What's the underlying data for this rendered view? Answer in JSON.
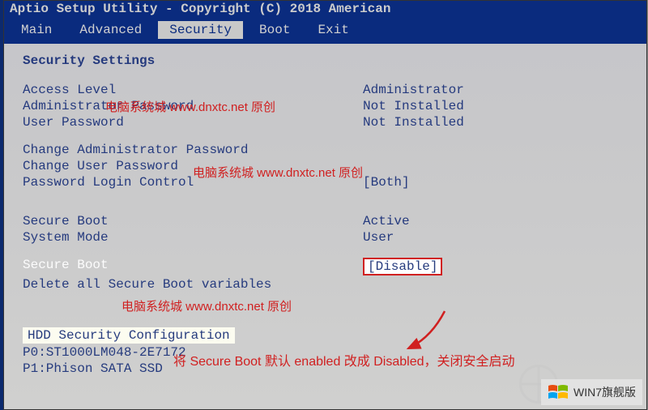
{
  "title_bar": "Aptio Setup Utility - Copyright (C) 2018 American",
  "nav": {
    "items": [
      "Main",
      "Advanced",
      "Security",
      "Boot",
      "Exit"
    ],
    "active_index": 2
  },
  "section_header": "Security Settings",
  "fields": {
    "access_level": {
      "label": "Access Level",
      "value": "Administrator"
    },
    "admin_pw": {
      "label": "Administrator Password",
      "value": "Not Installed"
    },
    "user_pw": {
      "label": "User Password",
      "value": "Not Installed"
    },
    "change_admin": {
      "label": "Change Administrator Password"
    },
    "change_user": {
      "label": "Change User Password"
    },
    "login_ctrl": {
      "label": "Password Login Control",
      "value": "[Both]"
    },
    "secure_boot_status": {
      "label": "Secure Boot",
      "value": "Active"
    },
    "system_mode": {
      "label": "System Mode",
      "value": "User"
    },
    "secure_boot_toggle": {
      "label": "Secure Boot",
      "value": "[Disable]"
    },
    "delete_vars": {
      "label": "Delete all Secure Boot variables"
    }
  },
  "hdd_section": {
    "header": "HDD Security Configuration",
    "drives": [
      "P0:ST1000LM048-2E7172",
      "P1:Phison SATA SSD"
    ]
  },
  "watermarks": {
    "wm1": "电脑系统城 www.dnxtc.net 原创",
    "wm2": "电脑系统城 www.dnxtc.net 原创",
    "wm3": "电脑系统城 www.dnxtc.net 原创"
  },
  "annotation": "将 Secure Boot 默认 enabled 改成 Disabled，关闭安全启动",
  "badge": "WIN7旗舰版"
}
